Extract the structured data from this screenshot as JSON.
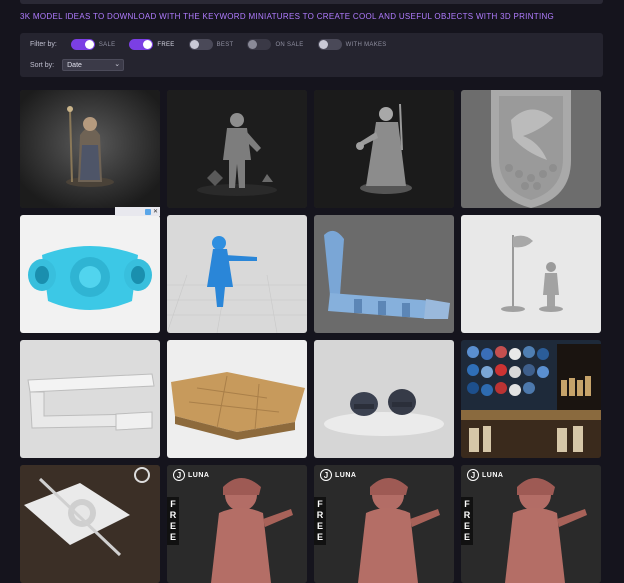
{
  "headline": "3K MODEL IDEAS TO DOWNLOAD WITH THE KEYWORD MINIATURES TO CREATE COOL AND USEFUL OBJECTS WITH 3D PRINTING",
  "filters": {
    "filter_label": "Filter by:",
    "toggles": [
      {
        "label": "SALE",
        "state": "on"
      },
      {
        "label": "FREE",
        "state": "on"
      },
      {
        "label": "BEST",
        "state": "off"
      },
      {
        "label": "ON SALE",
        "state": "dim"
      },
      {
        "label": "WITH MAKES",
        "state": "off"
      }
    ],
    "sort_label": "Sort by:",
    "sort_value": "Date"
  },
  "ad": {
    "close": "✕"
  },
  "luna": {
    "logo_letter": "J",
    "brand": "LUNA",
    "free_text": "FREE"
  },
  "cards": [
    {
      "name": "card-wizard-figure"
    },
    {
      "name": "card-zombie-figure"
    },
    {
      "name": "card-skeleton-mage"
    },
    {
      "name": "card-dragon-shield"
    },
    {
      "name": "card-blue-mech-part"
    },
    {
      "name": "card-blue-archer"
    },
    {
      "name": "card-robotic-arm"
    },
    {
      "name": "card-flag-soldier"
    },
    {
      "name": "card-grey-tray"
    },
    {
      "name": "card-wood-terrain"
    },
    {
      "name": "card-helmet-pair"
    },
    {
      "name": "card-paint-shelf"
    },
    {
      "name": "card-white-printer-part"
    },
    {
      "name": "card-luna-miniature-1"
    },
    {
      "name": "card-luna-miniature-2"
    },
    {
      "name": "card-luna-miniature-3"
    }
  ]
}
